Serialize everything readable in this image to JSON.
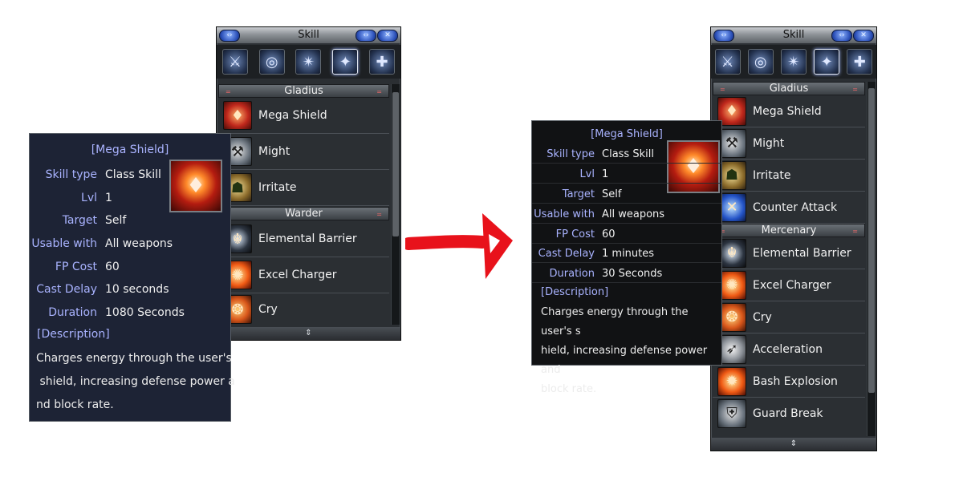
{
  "left": {
    "window": {
      "title": "Skill",
      "categories": [
        {
          "name": "Gladius",
          "skills": [
            {
              "name": "Mega Shield",
              "icon": "shield-emblem-icon",
              "theme": "red"
            },
            {
              "name": "Might",
              "icon": "might-icon",
              "theme": "steel"
            },
            {
              "name": "Irritate",
              "icon": "irritate-icon",
              "theme": "gold"
            }
          ]
        },
        {
          "name": "Warder",
          "skills": [
            {
              "name": "Elemental Barrier",
              "icon": "elemental-barrier-icon",
              "theme": "dark"
            },
            {
              "name": "Excel Charger",
              "icon": "excel-charger-icon",
              "theme": "fire"
            },
            {
              "name": "Cry",
              "icon": "cry-icon",
              "theme": "orange"
            }
          ]
        }
      ]
    },
    "tooltip": {
      "title": "[Mega Shield]",
      "rows": [
        {
          "label": "Skill type",
          "value": "Class Skill"
        },
        {
          "label": "Lvl",
          "value": "1"
        },
        {
          "label": "Target",
          "value": "Self"
        },
        {
          "label": "Usable with",
          "value": "All weapons"
        },
        {
          "label": "FP Cost",
          "value": "60"
        },
        {
          "label": "Cast Delay",
          "value": "10 seconds"
        },
        {
          "label": "Duration",
          "value": "1080 Seconds"
        }
      ],
      "description_label": "[Description]",
      "description_lines": [
        "Charges energy through the user's",
        " shield, increasing defense power a",
        "nd block rate."
      ]
    }
  },
  "right": {
    "window": {
      "title": "Skill",
      "categories": [
        {
          "name": "Gladius",
          "skills": [
            {
              "name": "Mega Shield",
              "icon": "shield-emblem-icon",
              "theme": "red"
            },
            {
              "name": "Might",
              "icon": "might-icon",
              "theme": "steel"
            },
            {
              "name": "Irritate",
              "icon": "irritate-icon",
              "theme": "gold"
            },
            {
              "name": "Counter Attack",
              "icon": "counter-attack-icon",
              "theme": "blue"
            }
          ]
        },
        {
          "name": "Mercenary",
          "skills": [
            {
              "name": "Elemental Barrier",
              "icon": "elemental-barrier-icon",
              "theme": "dark"
            },
            {
              "name": "Excel Charger",
              "icon": "excel-charger-icon",
              "theme": "fire"
            },
            {
              "name": "Cry",
              "icon": "cry-icon",
              "theme": "orange"
            },
            {
              "name": "Acceleration",
              "icon": "acceleration-icon",
              "theme": "gray"
            },
            {
              "name": "Bash Explosion",
              "icon": "bash-explosion-icon",
              "theme": "fire"
            },
            {
              "name": "Guard Break",
              "icon": "guard-break-icon",
              "theme": "steel"
            }
          ]
        }
      ]
    },
    "tooltip": {
      "title": "[Mega Shield]",
      "rows": [
        {
          "label": "Skill type",
          "value": "Class Skill"
        },
        {
          "label": "Lvl",
          "value": "1"
        },
        {
          "label": "Target",
          "value": "Self"
        },
        {
          "label": "Usable with",
          "value": "All weapons"
        },
        {
          "label": "FP Cost",
          "value": "60"
        },
        {
          "label": "Cast Delay",
          "value": "1 minutes"
        },
        {
          "label": "Duration",
          "value": "30 Seconds"
        }
      ],
      "description_label": "[Description]",
      "description_lines": [
        "Charges energy through the user's s",
        "hield, increasing defense power and",
        "block rate."
      ]
    }
  },
  "tabs": [
    "crossed-swords-icon",
    "target-icon",
    "shatter-icon",
    "holy-star-icon",
    "radiant-cross-icon"
  ],
  "colors": {
    "arrow": "#e8121b",
    "label_blue": "#a9b3ff"
  }
}
